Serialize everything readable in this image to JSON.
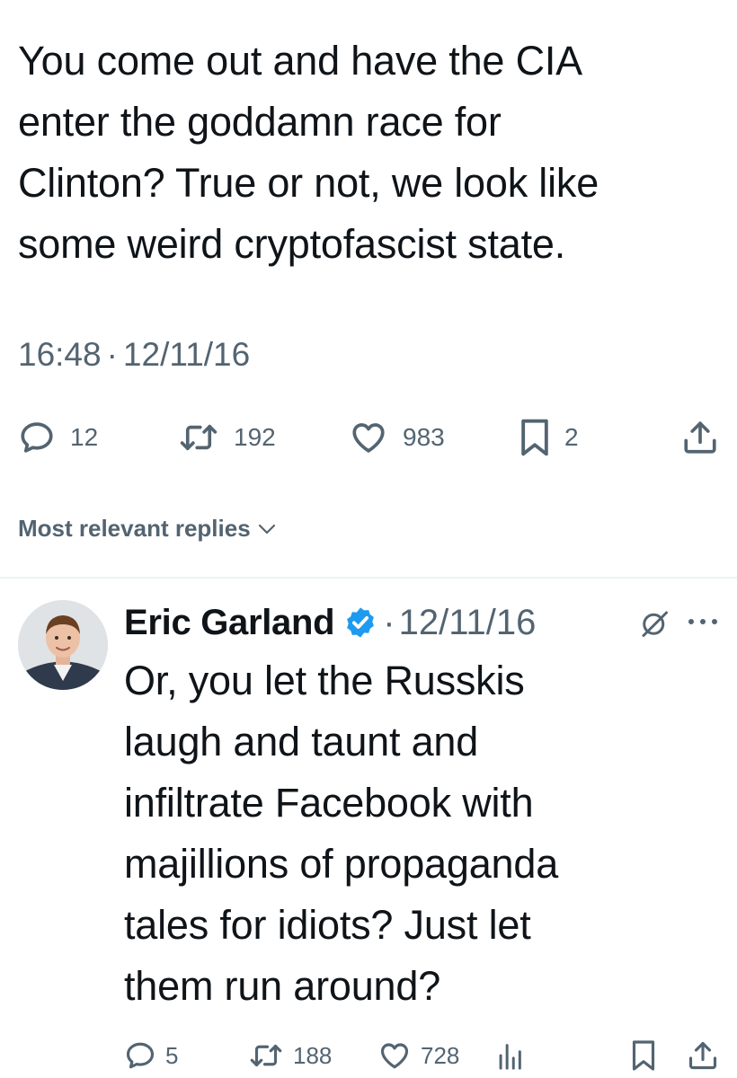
{
  "tweet": {
    "text": "You come out and have the CIA\nenter the goddamn race for\nClinton? True or not, we look like\nsome weird cryptofascist state.",
    "time": "16:48",
    "separator": "·",
    "date": "12/11/16",
    "replies": "12",
    "retweets": "192",
    "likes": "983",
    "bookmarks": "2"
  },
  "sort": {
    "label": "Most relevant replies"
  },
  "reply": {
    "name": "Eric Garland",
    "separator": "·",
    "date": "12/11/16",
    "text": "Or, you let the Russkis\nlaugh and taunt and\ninfiltrate Facebook with\nmajillions of propaganda\ntales for idiots? Just let\nthem run around?",
    "replies": "5",
    "retweets": "188",
    "likes": "728"
  },
  "icons": {
    "reply": "reply-bubble-icon",
    "retweet": "retweet-icon",
    "like": "heart-icon",
    "bookmark": "bookmark-icon",
    "share": "share-icon",
    "views": "analytics-icon",
    "verified": "verified-badge-icon",
    "grok": "grok-icon",
    "more": "more-icon"
  },
  "colors": {
    "text": "#0f1419",
    "secondary": "#536471",
    "verified": "#1d9bf0",
    "divider": "#eff3f4"
  }
}
